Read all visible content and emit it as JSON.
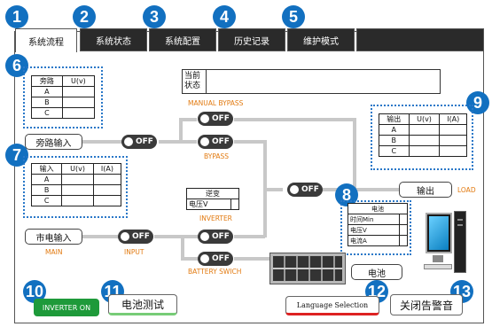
{
  "tabs": [
    {
      "label": "系统流程",
      "badge": "1"
    },
    {
      "label": "系统状态",
      "badge": "2"
    },
    {
      "label": "系统配置",
      "badge": "3"
    },
    {
      "label": "历史记录",
      "badge": "4"
    },
    {
      "label": "维护模式",
      "badge": "5"
    }
  ],
  "badges": {
    "bypass_table": "6",
    "input_table": "7",
    "battery_table": "8",
    "output_table": "9",
    "inverter_on": "10",
    "battery_test": "11",
    "language": "12",
    "alarm": "13"
  },
  "status": {
    "label_line1": "当前",
    "label_line2": "状态",
    "value": ""
  },
  "bypass_table": {
    "h1": "旁路",
    "h2": "U(v)",
    "rows": [
      "A",
      "B",
      "C"
    ]
  },
  "input_table": {
    "h1": "输入",
    "h2": "U(v)",
    "h3": "I(A)",
    "rows": [
      "A",
      "B",
      "C"
    ]
  },
  "output_table": {
    "h1": "输出",
    "h2": "U(v)",
    "h3": "I(A)",
    "rows": [
      "A",
      "B",
      "C"
    ]
  },
  "battery_table": {
    "title": "电池",
    "rows": [
      "时间Min",
      "电压V",
      "电流A"
    ]
  },
  "inverter_table": {
    "title": "逆变",
    "row": "电压V"
  },
  "buttons": {
    "bypass_input": "旁路输入",
    "mains_input": "市电输入",
    "output": "输出",
    "battery": "电池",
    "inverter_on": "INVERTER ON",
    "battery_test": "电池测试",
    "language": "Language Selection",
    "alarm": "关闭告警音"
  },
  "switch_label": "OFF",
  "labels": {
    "manual_bypass": "MANUAL BYPASS",
    "bypass": "BYPASS",
    "inverter": "INVERTER",
    "main": "MAIN",
    "input": "INPUT",
    "battery_switch": "BATTERY SWICH",
    "load": "LOAD"
  },
  "colors": {
    "badge": "#1270c0",
    "switch": "#3a3a3a",
    "orange_label": "#e27a10",
    "inverter_on_bg": "#1e9a3a",
    "dotted_border": "#2a78c8"
  }
}
